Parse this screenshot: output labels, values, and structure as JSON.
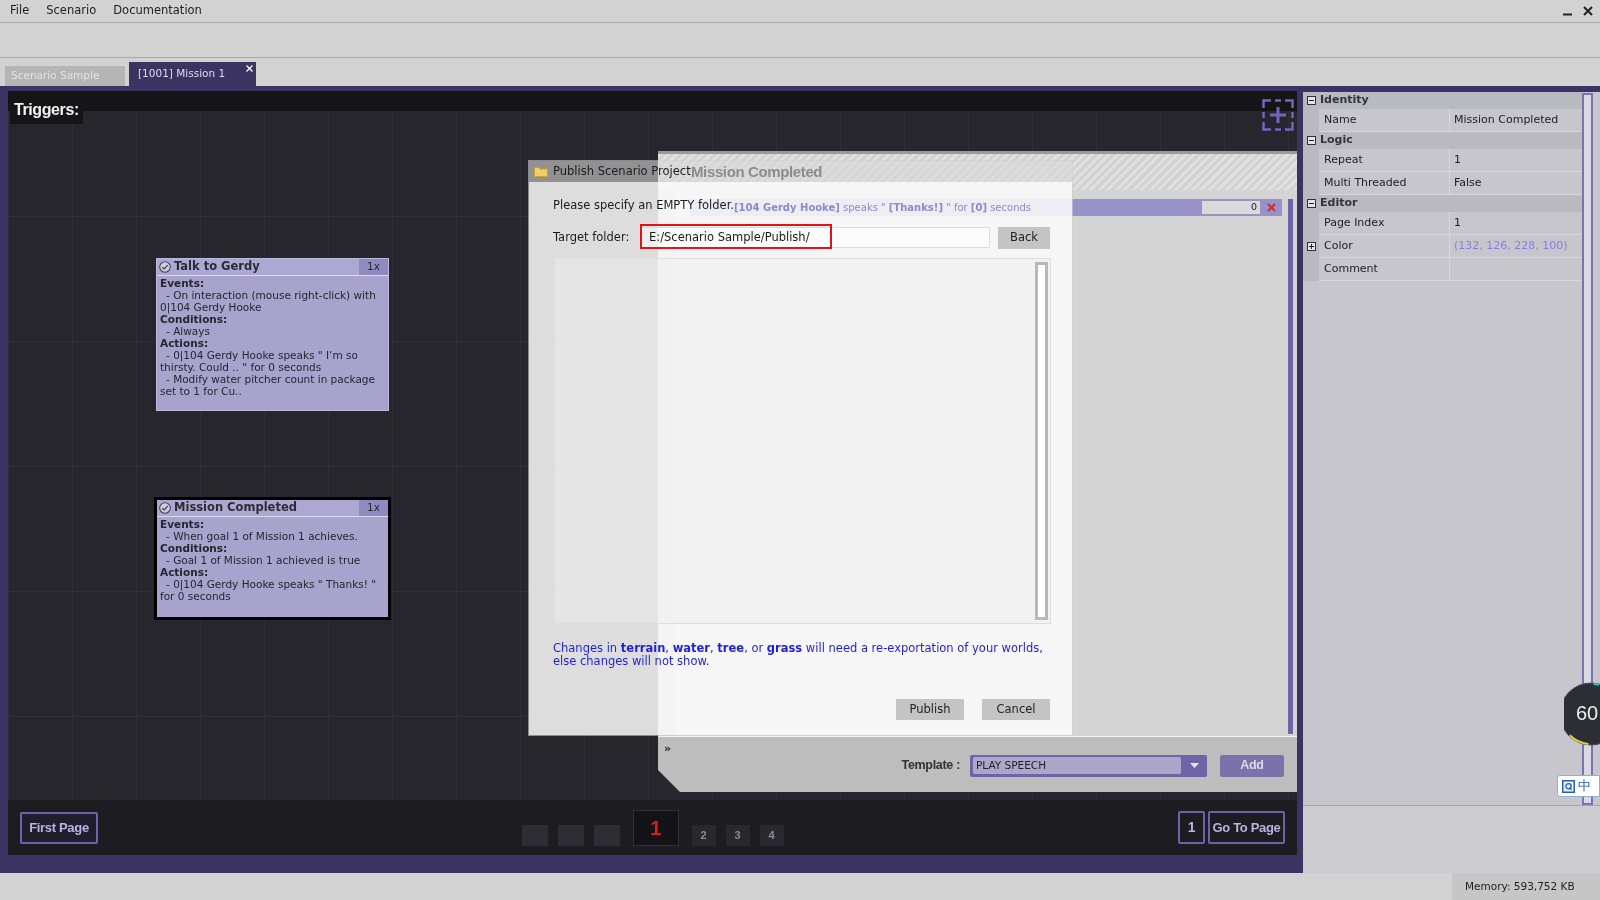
{
  "menu": [
    "File",
    "Scenario",
    "Documentation"
  ],
  "tabs": [
    {
      "label": "Scenario Sample",
      "selected": false,
      "closable": false
    },
    {
      "label": "[1001] Mission 1",
      "selected": true,
      "closable": true
    }
  ],
  "editor": {
    "title": "Triggers:",
    "triggers": [
      {
        "title": "Talk to Gerdy",
        "repeat": "1x",
        "selected": false,
        "sections": [
          {
            "heading": "Events:",
            "lines": [
              "- On interaction (mouse right-click) with 0|104 Gerdy Hooke"
            ]
          },
          {
            "heading": "Conditions:",
            "lines": [
              "- Always"
            ]
          },
          {
            "heading": "Actions:",
            "lines": [
              "- 0|104 Gerdy Hooke speaks \" I’m so thirsty. Could .. \" for 0 seconds",
              "- Modify water pitcher count in package set to 1 for Cu.."
            ]
          }
        ]
      },
      {
        "title": "Mission Completed",
        "repeat": "1x",
        "selected": true,
        "sections": [
          {
            "heading": "Events:",
            "lines": [
              "- When goal 1 of Mission 1 achieves."
            ]
          },
          {
            "heading": "Conditions:",
            "lines": [
              "- Goal 1 of Mission 1 achieved is true"
            ]
          },
          {
            "heading": "Actions:",
            "lines": [
              "- 0|104 Gerdy Hooke speaks \" Thanks! \" for 0 seconds"
            ]
          }
        ]
      }
    ],
    "trigger_panel": {
      "title": "Mission Completed",
      "actions": [
        {
          "text": "**[104 Gerdy Hooke]** speaks \" **[Thanks!]** \" for **[0]** seconds",
          "value": "0"
        }
      ],
      "expander": "»",
      "template_label": "Template :",
      "template_value": "PLAY SPEECH",
      "add_button": "Add"
    },
    "pagination": {
      "first_button": "First Page",
      "pages": [
        {
          "kind": "blank"
        },
        {
          "kind": "blank"
        },
        {
          "kind": "blank"
        },
        {
          "kind": "page",
          "label": "1",
          "selected": true
        },
        {
          "kind": "page",
          "label": "2",
          "selected": false
        },
        {
          "kind": "page",
          "label": "3",
          "selected": false
        },
        {
          "kind": "page",
          "label": "4",
          "selected": false
        }
      ],
      "page_input": "1",
      "goto_button": "Go To Page"
    }
  },
  "properties": [
    {
      "category": "Identity",
      "expanded": true,
      "rows": [
        {
          "name": "Name",
          "value": "Mission Completed",
          "expandable": false
        }
      ]
    },
    {
      "category": "Logic",
      "expanded": true,
      "rows": [
        {
          "name": "Repeat",
          "value": "1",
          "expandable": false
        },
        {
          "name": "Multi Threaded",
          "value": "False",
          "expandable": false
        }
      ]
    },
    {
      "category": "Editor",
      "expanded": true,
      "rows": [
        {
          "name": "Page Index",
          "value": "1",
          "expandable": false
        },
        {
          "name": "Color",
          "value": "(132, 126, 228, 100)",
          "expandable": true,
          "color": "#847ee4"
        },
        {
          "name": "Comment",
          "expandable": false
        }
      ]
    }
  ],
  "dialog": {
    "title": "Publish Scenario Project",
    "instruction": "Please specify an EMPTY folder.",
    "target_label": "Target folder:",
    "target_value": "E:/Scenario Sample/Publish/",
    "back_button": "Back",
    "note": "Changes in **terrain**, **water**, **tree**, or **grass** will need a re-exportation of your worlds, else changes will not show.",
    "buttons": [
      "Publish",
      "Cancel"
    ]
  },
  "fps_gauge": "60",
  "ime_indicator": "中",
  "status_bar": {
    "memory": "Memory: 593,752 KB"
  }
}
